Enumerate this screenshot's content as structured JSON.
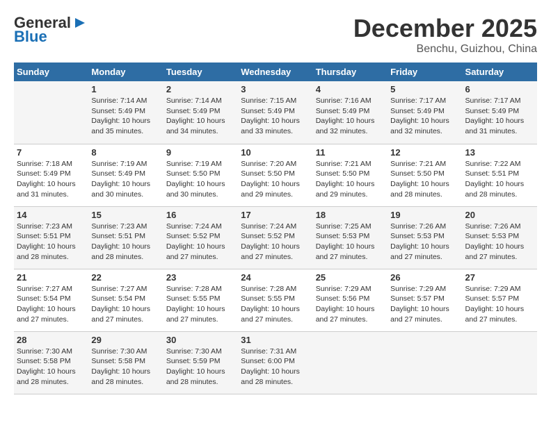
{
  "logo": {
    "line1": "General",
    "line2": "Blue"
  },
  "title": "December 2025",
  "subtitle": "Benchu, Guizhou, China",
  "days_of_week": [
    "Sunday",
    "Monday",
    "Tuesday",
    "Wednesday",
    "Thursday",
    "Friday",
    "Saturday"
  ],
  "weeks": [
    [
      {
        "day": "",
        "info": ""
      },
      {
        "day": "1",
        "info": "Sunrise: 7:14 AM\nSunset: 5:49 PM\nDaylight: 10 hours\nand 35 minutes."
      },
      {
        "day": "2",
        "info": "Sunrise: 7:14 AM\nSunset: 5:49 PM\nDaylight: 10 hours\nand 34 minutes."
      },
      {
        "day": "3",
        "info": "Sunrise: 7:15 AM\nSunset: 5:49 PM\nDaylight: 10 hours\nand 33 minutes."
      },
      {
        "day": "4",
        "info": "Sunrise: 7:16 AM\nSunset: 5:49 PM\nDaylight: 10 hours\nand 32 minutes."
      },
      {
        "day": "5",
        "info": "Sunrise: 7:17 AM\nSunset: 5:49 PM\nDaylight: 10 hours\nand 32 minutes."
      },
      {
        "day": "6",
        "info": "Sunrise: 7:17 AM\nSunset: 5:49 PM\nDaylight: 10 hours\nand 31 minutes."
      }
    ],
    [
      {
        "day": "7",
        "info": "Sunrise: 7:18 AM\nSunset: 5:49 PM\nDaylight: 10 hours\nand 31 minutes."
      },
      {
        "day": "8",
        "info": "Sunrise: 7:19 AM\nSunset: 5:49 PM\nDaylight: 10 hours\nand 30 minutes."
      },
      {
        "day": "9",
        "info": "Sunrise: 7:19 AM\nSunset: 5:50 PM\nDaylight: 10 hours\nand 30 minutes."
      },
      {
        "day": "10",
        "info": "Sunrise: 7:20 AM\nSunset: 5:50 PM\nDaylight: 10 hours\nand 29 minutes."
      },
      {
        "day": "11",
        "info": "Sunrise: 7:21 AM\nSunset: 5:50 PM\nDaylight: 10 hours\nand 29 minutes."
      },
      {
        "day": "12",
        "info": "Sunrise: 7:21 AM\nSunset: 5:50 PM\nDaylight: 10 hours\nand 28 minutes."
      },
      {
        "day": "13",
        "info": "Sunrise: 7:22 AM\nSunset: 5:51 PM\nDaylight: 10 hours\nand 28 minutes."
      }
    ],
    [
      {
        "day": "14",
        "info": "Sunrise: 7:23 AM\nSunset: 5:51 PM\nDaylight: 10 hours\nand 28 minutes."
      },
      {
        "day": "15",
        "info": "Sunrise: 7:23 AM\nSunset: 5:51 PM\nDaylight: 10 hours\nand 28 minutes."
      },
      {
        "day": "16",
        "info": "Sunrise: 7:24 AM\nSunset: 5:52 PM\nDaylight: 10 hours\nand 27 minutes."
      },
      {
        "day": "17",
        "info": "Sunrise: 7:24 AM\nSunset: 5:52 PM\nDaylight: 10 hours\nand 27 minutes."
      },
      {
        "day": "18",
        "info": "Sunrise: 7:25 AM\nSunset: 5:53 PM\nDaylight: 10 hours\nand 27 minutes."
      },
      {
        "day": "19",
        "info": "Sunrise: 7:26 AM\nSunset: 5:53 PM\nDaylight: 10 hours\nand 27 minutes."
      },
      {
        "day": "20",
        "info": "Sunrise: 7:26 AM\nSunset: 5:53 PM\nDaylight: 10 hours\nand 27 minutes."
      }
    ],
    [
      {
        "day": "21",
        "info": "Sunrise: 7:27 AM\nSunset: 5:54 PM\nDaylight: 10 hours\nand 27 minutes."
      },
      {
        "day": "22",
        "info": "Sunrise: 7:27 AM\nSunset: 5:54 PM\nDaylight: 10 hours\nand 27 minutes."
      },
      {
        "day": "23",
        "info": "Sunrise: 7:28 AM\nSunset: 5:55 PM\nDaylight: 10 hours\nand 27 minutes."
      },
      {
        "day": "24",
        "info": "Sunrise: 7:28 AM\nSunset: 5:55 PM\nDaylight: 10 hours\nand 27 minutes."
      },
      {
        "day": "25",
        "info": "Sunrise: 7:29 AM\nSunset: 5:56 PM\nDaylight: 10 hours\nand 27 minutes."
      },
      {
        "day": "26",
        "info": "Sunrise: 7:29 AM\nSunset: 5:57 PM\nDaylight: 10 hours\nand 27 minutes."
      },
      {
        "day": "27",
        "info": "Sunrise: 7:29 AM\nSunset: 5:57 PM\nDaylight: 10 hours\nand 27 minutes."
      }
    ],
    [
      {
        "day": "28",
        "info": "Sunrise: 7:30 AM\nSunset: 5:58 PM\nDaylight: 10 hours\nand 28 minutes."
      },
      {
        "day": "29",
        "info": "Sunrise: 7:30 AM\nSunset: 5:58 PM\nDaylight: 10 hours\nand 28 minutes."
      },
      {
        "day": "30",
        "info": "Sunrise: 7:30 AM\nSunset: 5:59 PM\nDaylight: 10 hours\nand 28 minutes."
      },
      {
        "day": "31",
        "info": "Sunrise: 7:31 AM\nSunset: 6:00 PM\nDaylight: 10 hours\nand 28 minutes."
      },
      {
        "day": "",
        "info": ""
      },
      {
        "day": "",
        "info": ""
      },
      {
        "day": "",
        "info": ""
      }
    ]
  ]
}
